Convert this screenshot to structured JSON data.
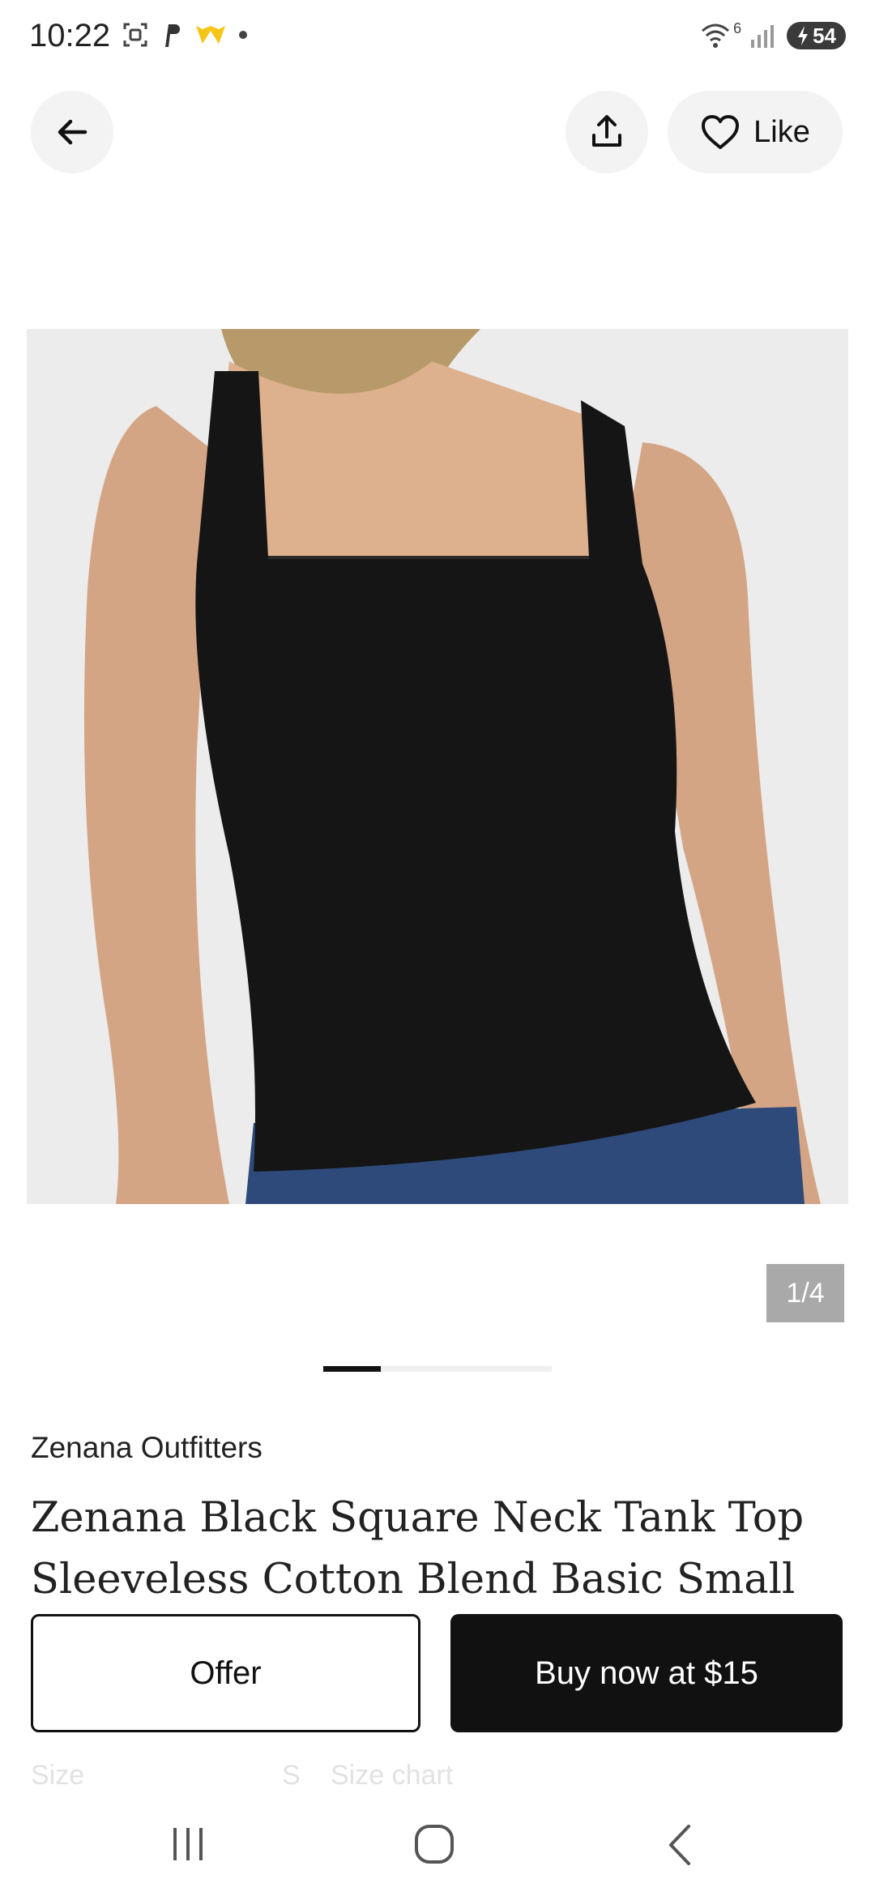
{
  "status": {
    "time": "10:22",
    "signal_badge": "6",
    "battery": "54"
  },
  "header": {
    "like_label": "Like"
  },
  "product": {
    "image_counter": "1/4",
    "carousel": {
      "current": 1,
      "total": 4
    },
    "brand": "Zenana Outfitters",
    "title": "Zenana Black Square Neck Tank Top Sleeveless Cotton Blend Basic  Small"
  },
  "details_partial": {
    "size_label": "Size",
    "size_value": "S",
    "size_chart": "Size chart"
  },
  "actions": {
    "offer_label": "Offer",
    "buy_label": "Buy now at $15"
  },
  "colors": {
    "accent": "#111111",
    "background": "#ffffff",
    "button_bg": "#f3f3f3"
  }
}
